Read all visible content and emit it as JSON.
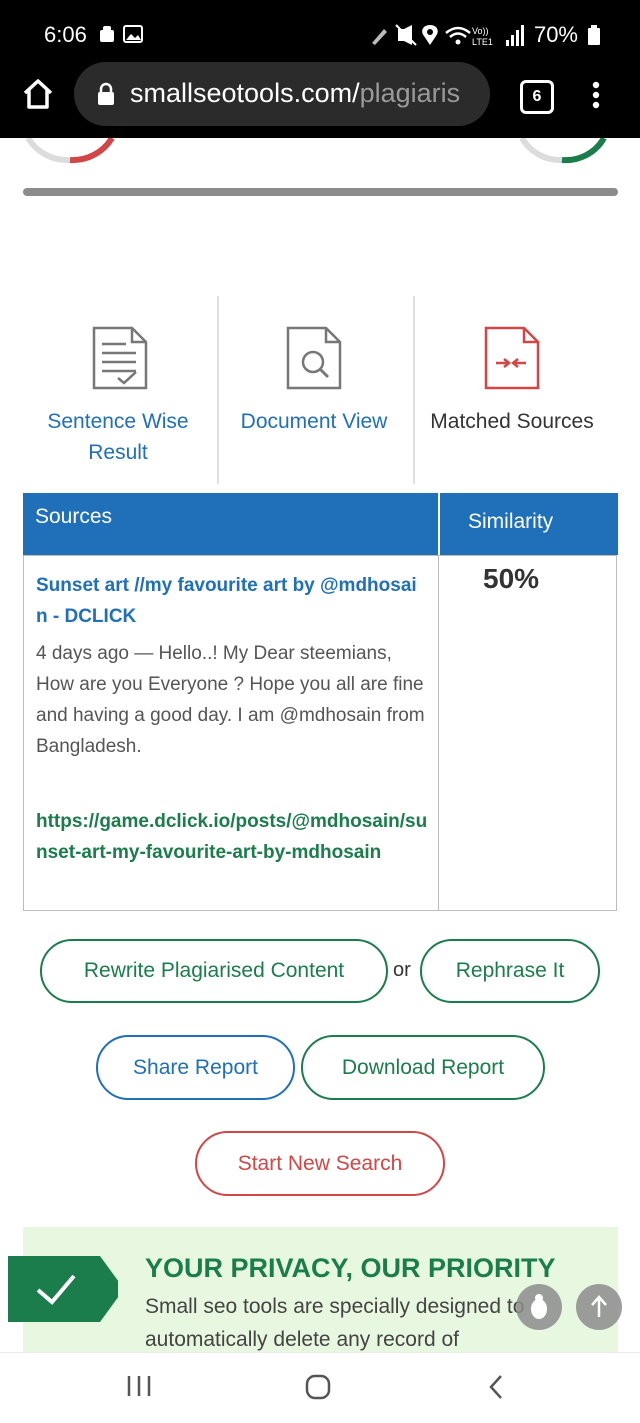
{
  "status_bar": {
    "time": "6:06",
    "battery": "70%",
    "network": "Vo)) LTE1"
  },
  "browser": {
    "url_domain": "smallseotools.com/",
    "url_path": "plagiaris",
    "tab_count": "6"
  },
  "tabs": [
    {
      "label": "Sentence Wise Result",
      "icon": "document-check-icon",
      "active": false
    },
    {
      "label": "Document View",
      "icon": "document-search-icon",
      "active": false
    },
    {
      "label": "Matched Sources",
      "icon": "matched-sources-icon",
      "active": true
    }
  ],
  "table": {
    "headers": {
      "sources": "Sources",
      "similarity": "Similarity"
    },
    "rows": [
      {
        "title": "Sunset art //my favourite art by @mdhosain - DCLICK",
        "description": "4 days ago — Hello..! My Dear steemians, How are you Everyone ? Hope you all are fine and having a good day. I am @mdhosain from Bangladesh.",
        "url": "https://game.dclick.io/posts/@mdhosain/sunset-art-my-favourite-art-by-mdhosain",
        "similarity": "50%"
      }
    ]
  },
  "actions": {
    "rewrite": "Rewrite Plagiarised Content",
    "or": "or",
    "rephrase": "Rephrase It",
    "share": "Share Report",
    "download": "Download Report",
    "new_search": "Start New Search"
  },
  "privacy": {
    "title": "YOUR PRIVACY, OUR PRIORITY",
    "text": "Small seo tools are specially designed to automatically delete any record of"
  },
  "colors": {
    "blue": "#1f6fb9",
    "green": "#1a7d4b",
    "red": "#d24646",
    "privacy_bg": "#e7f7e0"
  }
}
